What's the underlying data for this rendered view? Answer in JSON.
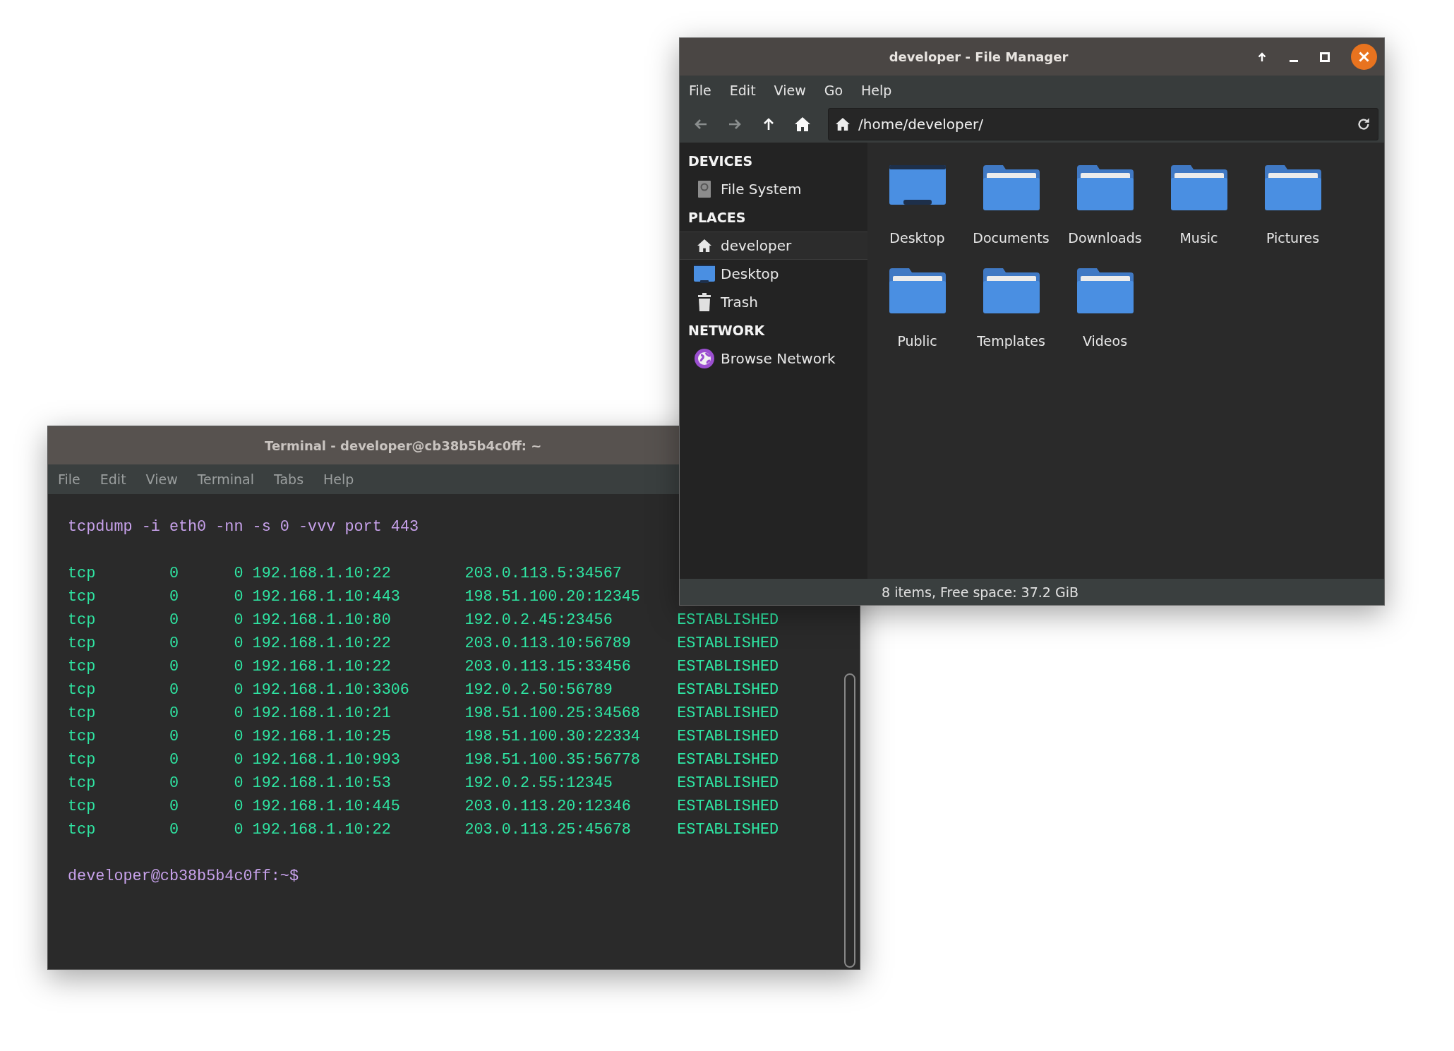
{
  "file_manager": {
    "title": "developer - File Manager",
    "menu": [
      "File",
      "Edit",
      "View",
      "Go",
      "Help"
    ],
    "toolbar": [
      {
        "kind": "back",
        "disabled": true
      },
      {
        "kind": "forward",
        "disabled": true
      },
      {
        "kind": "up",
        "disabled": false
      },
      {
        "kind": "home",
        "disabled": false
      }
    ],
    "location": "/home/developer/",
    "sidebar": [
      {
        "heading": "DEVICES",
        "items": [
          {
            "label": "File System",
            "kind": "drive",
            "selected": false
          }
        ]
      },
      {
        "heading": "PLACES",
        "items": [
          {
            "label": "developer",
            "kind": "home",
            "selected": true
          },
          {
            "label": "Desktop",
            "kind": "desktop",
            "selected": false
          },
          {
            "label": "Trash",
            "kind": "trash",
            "selected": false
          }
        ]
      },
      {
        "heading": "NETWORK",
        "items": [
          {
            "label": "Browse Network",
            "kind": "network",
            "selected": false
          }
        ]
      }
    ],
    "items": [
      {
        "label": "Desktop",
        "kind": "desktop"
      },
      {
        "label": "Documents",
        "kind": "folder"
      },
      {
        "label": "Downloads",
        "kind": "folder"
      },
      {
        "label": "Music",
        "kind": "folder"
      },
      {
        "label": "Pictures",
        "kind": "folder"
      },
      {
        "label": "Public",
        "kind": "folder"
      },
      {
        "label": "Templates",
        "kind": "folder"
      },
      {
        "label": "Videos",
        "kind": "folder"
      }
    ],
    "status_bar": "8 items, Free space: 37.2 GiB"
  },
  "terminal": {
    "title": "Terminal - developer@cb38b5b4c0ff: ~",
    "menu": [
      "File",
      "Edit",
      "View",
      "Terminal",
      "Tabs",
      "Help"
    ],
    "command": "tcpdump -i eth0 -nn -s 0 -vvv port 443",
    "rows": [
      {
        "proto": "tcp",
        "recv_q": "0",
        "send_q": "0",
        "local": "192.168.1.10:22",
        "foreign": "203.0.113.5:34567"
      },
      {
        "proto": "tcp",
        "recv_q": "0",
        "send_q": "0",
        "local": "192.168.1.10:443",
        "foreign": "198.51.100.20:12345"
      },
      {
        "proto": "tcp",
        "recv_q": "0",
        "send_q": "0",
        "local": "192.168.1.10:80",
        "foreign": "192.0.2.45:23456",
        "state": "ESTABLISHED"
      },
      {
        "proto": "tcp",
        "recv_q": "0",
        "send_q": "0",
        "local": "192.168.1.10:22",
        "foreign": "203.0.113.10:56789",
        "state": "ESTABLISHED"
      },
      {
        "proto": "tcp",
        "recv_q": "0",
        "send_q": "0",
        "local": "192.168.1.10:22",
        "foreign": "203.0.113.15:33456",
        "state": "ESTABLISHED"
      },
      {
        "proto": "tcp",
        "recv_q": "0",
        "send_q": "0",
        "local": "192.168.1.10:3306",
        "foreign": "192.0.2.50:56789",
        "state": "ESTABLISHED"
      },
      {
        "proto": "tcp",
        "recv_q": "0",
        "send_q": "0",
        "local": "192.168.1.10:21",
        "foreign": "198.51.100.25:34568",
        "state": "ESTABLISHED"
      },
      {
        "proto": "tcp",
        "recv_q": "0",
        "send_q": "0",
        "local": "192.168.1.10:25",
        "foreign": "198.51.100.30:22334",
        "state": "ESTABLISHED"
      },
      {
        "proto": "tcp",
        "recv_q": "0",
        "send_q": "0",
        "local": "192.168.1.10:993",
        "foreign": "198.51.100.35:56778",
        "state": "ESTABLISHED"
      },
      {
        "proto": "tcp",
        "recv_q": "0",
        "send_q": "0",
        "local": "192.168.1.10:53",
        "foreign": "192.0.2.55:12345",
        "state": "ESTABLISHED"
      },
      {
        "proto": "tcp",
        "recv_q": "0",
        "send_q": "0",
        "local": "192.168.1.10:445",
        "foreign": "203.0.113.20:12346",
        "state": "ESTABLISHED"
      },
      {
        "proto": "tcp",
        "recv_q": "0",
        "send_q": "0",
        "local": "192.168.1.10:22",
        "foreign": "203.0.113.25:45678",
        "state": "ESTABLISHED"
      }
    ],
    "prompt": "developer@cb38b5b4c0ff:~$"
  }
}
